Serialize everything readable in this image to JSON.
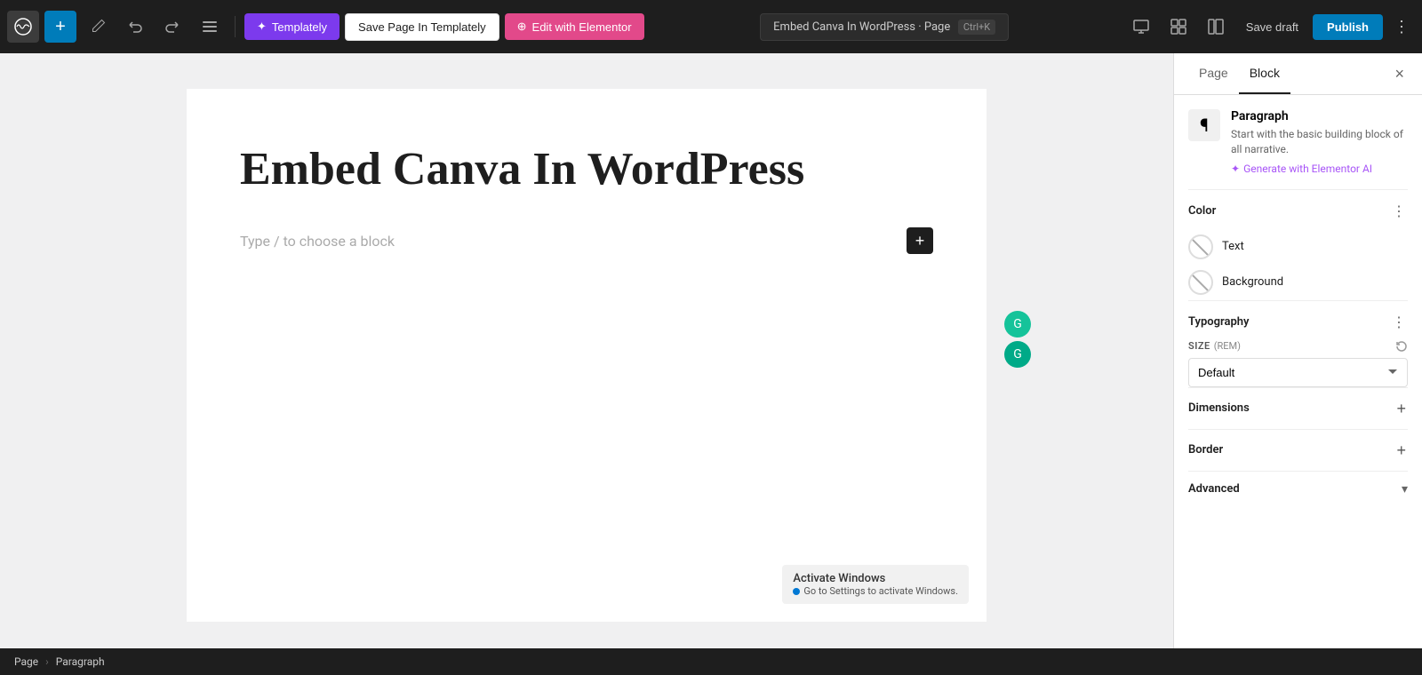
{
  "toolbar": {
    "add_label": "+",
    "templately_label": "Templately",
    "save_templately_label": "Save Page In Templately",
    "elementor_label": "Edit with Elementor",
    "page_title": "Embed Canva In WordPress · Page",
    "shortcut": "Ctrl+K",
    "save_draft_label": "Save draft",
    "publish_label": "Publish",
    "more_label": "⋮"
  },
  "sidebar": {
    "tab_page_label": "Page",
    "tab_block_label": "Block",
    "close_label": "×",
    "block_name": "Paragraph",
    "block_description": "Start with the basic building block of all narrative.",
    "generate_ai_label": "Generate with Elementor AI",
    "color_section_title": "Color",
    "text_label": "Text",
    "background_label": "Background",
    "typography_section_title": "Typography",
    "size_label": "SIZE",
    "size_unit": "(REM)",
    "size_default": "Default",
    "dimensions_label": "Dimensions",
    "border_label": "Border",
    "advanced_label": "Advanced"
  },
  "editor": {
    "heading": "Embed Canva In WordPress",
    "placeholder": "Type / to choose a block"
  },
  "breadcrumb": {
    "items": [
      "Page",
      "Paragraph"
    ],
    "separator": "›"
  },
  "activate_windows": {
    "line1": "Activate Windows",
    "line2": "Go to Settings to activate Windows."
  }
}
